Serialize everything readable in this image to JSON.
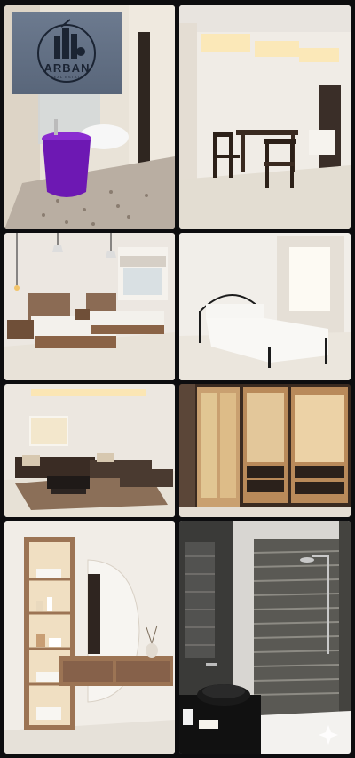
{
  "logo": {
    "brand": "ARBAN",
    "subtitle": "REAL ESTATE"
  },
  "tiles": [
    {
      "name": "bathroom-purple-basin"
    },
    {
      "name": "dining-room"
    },
    {
      "name": "twin-bedroom"
    },
    {
      "name": "master-bedroom"
    },
    {
      "name": "living-room"
    },
    {
      "name": "wardrobe"
    },
    {
      "name": "vanity-shelf"
    },
    {
      "name": "shower-room"
    }
  ],
  "colors": {
    "background": "#0d0d0f",
    "logo_bg": "#637189",
    "logo_text": "#1b2433"
  },
  "icons": [
    "building-logo-icon"
  ]
}
